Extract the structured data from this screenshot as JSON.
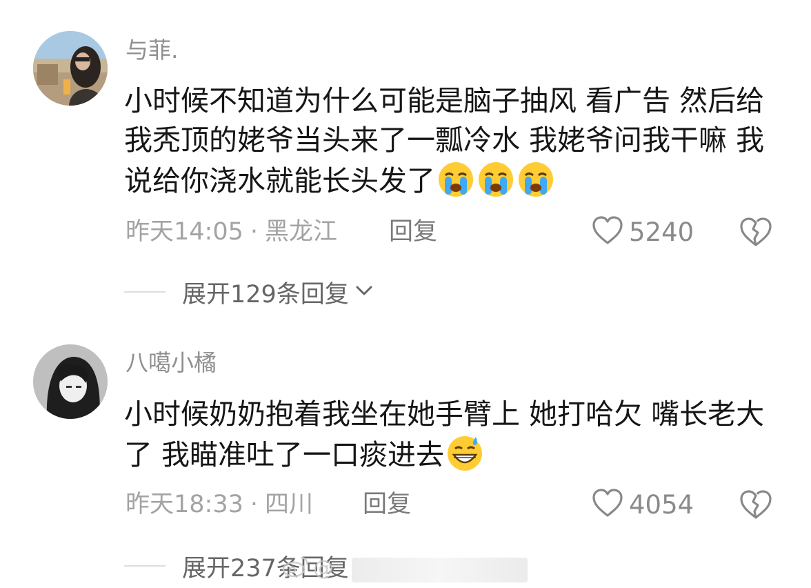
{
  "comments": [
    {
      "username": "与菲.",
      "text": "小时候不知道为什么可能是脑子抽风 看广告 然后给我秃顶的姥爷当头来了一瓢冷水 我姥爷问我干嘛 我说给你浇水就能长头发了",
      "emojis": [
        "crying-emoji",
        "crying-emoji",
        "crying-emoji"
      ],
      "time": "昨天14:05",
      "separator": "·",
      "location": "黑龙江",
      "reply_label": "回复",
      "likes": "5240",
      "expand_label": "展开129条回复"
    },
    {
      "username": "八噶小橘",
      "text": "小时候奶奶抱着我坐在她手臂上 她打哈欠 嘴长老大了 我瞄准吐了一口痰进去",
      "emojis": [
        "grin-sweat-emoji"
      ],
      "time": "昨天18:33",
      "separator": "·",
      "location": "四川",
      "reply_label": "回复",
      "likes": "4054",
      "expand_label": "展开237条回复"
    }
  ],
  "watermark": {
    "text": "@"
  },
  "colors": {
    "text": "#161616",
    "meta": "#a3a3a3",
    "username": "#8f8f8f"
  }
}
